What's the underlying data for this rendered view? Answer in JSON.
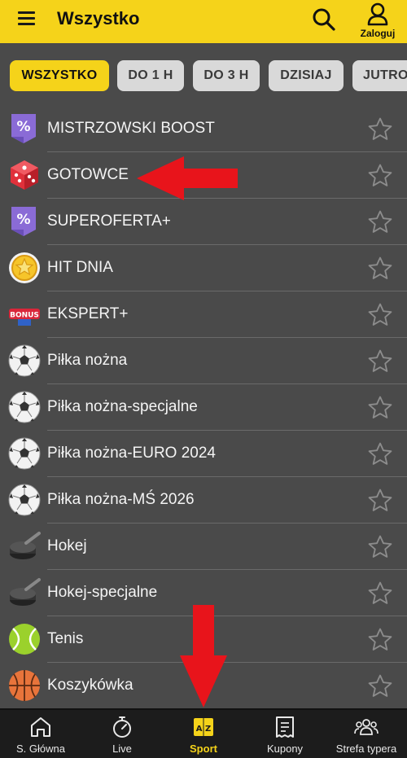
{
  "header": {
    "title": "Wszystko",
    "login_label": "Zaloguj",
    "menu_icon": "hamburger-icon",
    "search_icon": "search-icon",
    "user_icon": "user-icon"
  },
  "filters": [
    {
      "label": "WSZYSTKO",
      "active": true
    },
    {
      "label": "DO 1 H",
      "active": false
    },
    {
      "label": "DO 3 H",
      "active": false
    },
    {
      "label": "DZISIAJ",
      "active": false
    },
    {
      "label": "JUTRO",
      "active": false
    }
  ],
  "list": [
    {
      "label": "MISTRZOWSKI BOOST",
      "icon": "percent-ribbon-icon"
    },
    {
      "label": "GOTOWCE",
      "icon": "dice-icon"
    },
    {
      "label": "SUPEROFERTA+",
      "icon": "percent-ribbon-icon"
    },
    {
      "label": "HIT DNIA",
      "icon": "star-coin-icon"
    },
    {
      "label": "EKSPERT+",
      "icon": "bonus-icon",
      "icon_text": "BONUS"
    },
    {
      "label": "Piłka nożna",
      "icon": "soccer-ball-icon"
    },
    {
      "label": "Piłka nożna-specjalne",
      "icon": "soccer-ball-icon"
    },
    {
      "label": "Piłka nożna-EURO 2024",
      "icon": "soccer-ball-icon"
    },
    {
      "label": "Piłka nożna-MŚ 2026",
      "icon": "soccer-ball-icon"
    },
    {
      "label": "Hokej",
      "icon": "hockey-puck-icon"
    },
    {
      "label": "Hokej-specjalne",
      "icon": "hockey-puck-icon"
    },
    {
      "label": "Tenis",
      "icon": "tennis-ball-icon"
    },
    {
      "label": "Koszykówka",
      "icon": "basketball-icon"
    }
  ],
  "bottom_nav": [
    {
      "label": "S. Główna",
      "icon": "home-icon",
      "active": false
    },
    {
      "label": "Live",
      "icon": "stopwatch-icon",
      "active": false
    },
    {
      "label": "Sport",
      "icon": "az-icon",
      "icon_text": "A Z",
      "active": true
    },
    {
      "label": "Kupony",
      "icon": "coupon-icon",
      "active": false
    },
    {
      "label": "Strefa typera",
      "icon": "group-icon",
      "active": false
    }
  ],
  "colors": {
    "accent": "#f5d31a",
    "background": "#4a4a4a",
    "annotation_arrow": "#e8141b",
    "nav_background": "#1c1c1c"
  }
}
